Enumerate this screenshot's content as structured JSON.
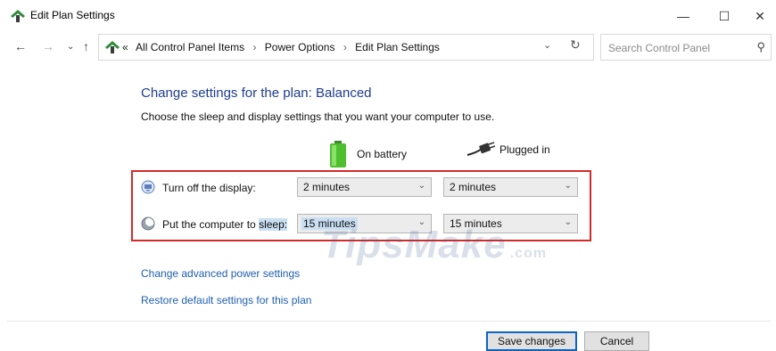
{
  "window": {
    "title": "Edit Plan Settings",
    "controls": {
      "minimize": "—",
      "maximize": "☐",
      "close": "✕"
    }
  },
  "nav": {
    "back_icon": "back-arrow-icon",
    "forward_icon": "forward-arrow-icon",
    "recent_icon": "chevron-down-icon",
    "up_icon": "up-arrow-icon"
  },
  "address": {
    "prefix": "«",
    "crumbs": [
      "All Control Panel Items",
      "Power Options",
      "Edit Plan Settings"
    ]
  },
  "search": {
    "placeholder": "Search Control Panel"
  },
  "main": {
    "heading": "Change settings for the plan: Balanced",
    "subtext": "Choose the sleep and display settings that you want your computer to use.",
    "columns": {
      "battery": "On battery",
      "plugged": "Plugged in"
    },
    "rows": [
      {
        "label": "Turn off the display:",
        "battery_value": "2 minutes",
        "plugged_value": "2 minutes"
      },
      {
        "label_plain": "Put the computer to ",
        "label_highlighted": "sleep:",
        "battery_value": "15 minutes",
        "plugged_value": "15 minutes"
      }
    ],
    "links": {
      "advanced": "Change advanced power settings",
      "restore": "Restore default settings for this plan"
    }
  },
  "footer": {
    "save": "Save changes",
    "cancel": "Cancel"
  },
  "watermark": {
    "main": "TipsMake",
    "suffix": ".com"
  },
  "colors": {
    "heading": "#1e3c8f",
    "link": "#1e5fb0",
    "highlight_border": "#d42a2a",
    "selection": "#c9dff2"
  }
}
